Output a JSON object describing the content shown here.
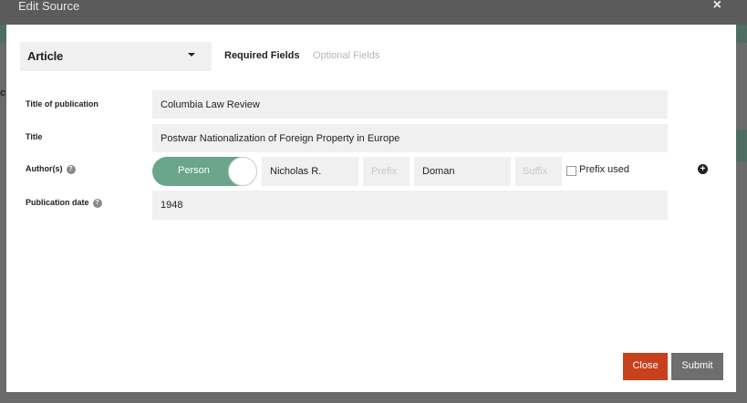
{
  "window": {
    "title": "Edit Source",
    "close_glyph": "×"
  },
  "source_type": {
    "selected": "Article"
  },
  "tabs": [
    {
      "label": "Required Fields",
      "active": true
    },
    {
      "label": "Optional Fields",
      "active": false
    }
  ],
  "fields": {
    "title_of_publication": {
      "label": "Title of publication",
      "value": "Columbia Law Review"
    },
    "title": {
      "label": "Title",
      "value": "Postwar Nationalization of Foreign Property in Europe"
    },
    "authors": {
      "label": "Author(s)",
      "help_glyph": "?",
      "type_toggle": "Person",
      "first_name": "Nicholas R.",
      "prefix_placeholder": "Prefix",
      "last_name": "Doman",
      "suffix_placeholder": "Suffix",
      "prefix_used_label": "Prefix used",
      "prefix_used_checked": false,
      "add_glyph": "+"
    },
    "publication_date": {
      "label": "Publication date",
      "help_glyph": "?",
      "value": "1948"
    }
  },
  "buttons": {
    "close": "Close",
    "submit": "Submit"
  },
  "background": {
    "letter": "c"
  },
  "colors": {
    "toggle": "#6aa58c",
    "close_button": "#c9401c",
    "submit_button": "#6e6e6e",
    "field_background": "#f0f0f0"
  }
}
